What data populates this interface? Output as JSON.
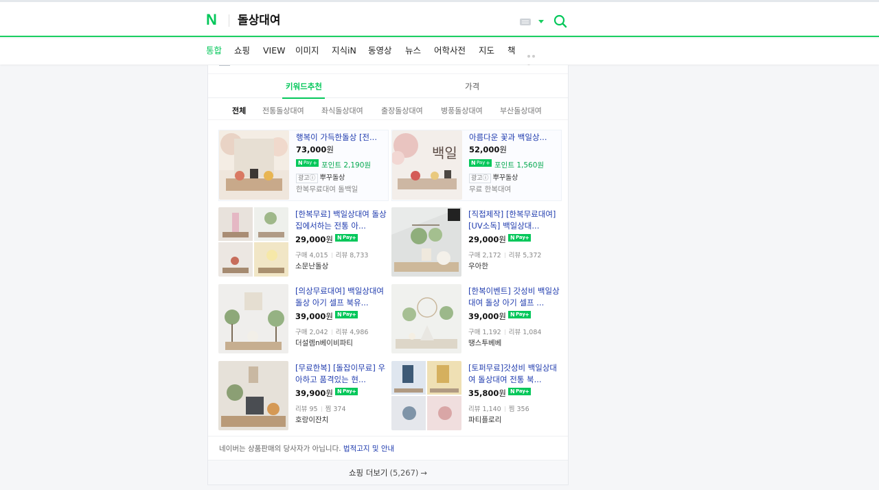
{
  "header": {
    "logo": "N",
    "query": "돌상대여",
    "search_icon": "search-icon",
    "keyboard_icon": "keyboard-icon",
    "accent_color": "#03c75a"
  },
  "tabs": [
    {
      "label": "통합",
      "active": true
    },
    {
      "label": "쇼핑"
    },
    {
      "label": "VIEW"
    },
    {
      "label": "이미지"
    },
    {
      "label": "지식iN"
    },
    {
      "label": "동영상"
    },
    {
      "label": "뉴스"
    },
    {
      "label": "어학사전"
    },
    {
      "label": "지도"
    },
    {
      "label": "책"
    }
  ],
  "shopping": {
    "subtabs": [
      {
        "label": "키워드추천",
        "active": true
      },
      {
        "label": "가격"
      }
    ],
    "filters": [
      {
        "label": "전체",
        "active": true
      },
      {
        "label": "전통돌상대여"
      },
      {
        "label": "좌식돌상대여"
      },
      {
        "label": "출장돌상대여"
      },
      {
        "label": "병풍돌상대여"
      },
      {
        "label": "부산돌상대여"
      }
    ],
    "products": [
      {
        "title": "행복이 가득한돌상 [전...",
        "price": "73,000",
        "won": "원",
        "npay": true,
        "points_label": "포인트",
        "points": "2,190원",
        "ad_label": "광고ⓘ",
        "ad_shop": "뿌꾸돌상",
        "seller": "한복무료대여 돌백일",
        "ad": true
      },
      {
        "title": "아름다운 꽃과 백일상...",
        "price": "52,000",
        "won": "원",
        "npay": true,
        "points_label": "포인트",
        "points": "1,560원",
        "ad_label": "광고ⓘ",
        "ad_shop": "뿌꾸돌상",
        "seller": "무료 한복대여",
        "ad": true
      },
      {
        "title": "[한복무료] 백일상대여 돌상 집에서하는 전통 아...",
        "price": "29,000",
        "won": "원",
        "npay": true,
        "stat1_label": "구매",
        "stat1": "4,015",
        "stat2_label": "리뷰",
        "stat2": "8,733",
        "seller": "소문난돌상"
      },
      {
        "title": "[직접제작] [한복무료대여] [UV소독] 백일상대...",
        "price": "29,000",
        "won": "원",
        "npay": true,
        "stat1_label": "구매",
        "stat1": "2,172",
        "stat2_label": "리뷰",
        "stat2": "5,372",
        "seller": "우아한"
      },
      {
        "title": "[의상무료대여] 백일상대여 돌상 아기 셀프 북유...",
        "price": "39,000",
        "won": "원",
        "npay": true,
        "stat1_label": "구매",
        "stat1": "2,042",
        "stat2_label": "리뷰",
        "stat2": "4,986",
        "seller": "더설렘n베이비파티"
      },
      {
        "title": "[한복이벤트] 갓성비 백일상대여 돌상 아기 셀프 ...",
        "price": "39,000",
        "won": "원",
        "npay": true,
        "stat1_label": "구매",
        "stat1": "1,192",
        "stat2_label": "리뷰",
        "stat2": "1,084",
        "seller": "땡스투베베"
      },
      {
        "title": "[무료한복] [돌잡이무료] 우아하고 품격있는 현...",
        "price": "39,900",
        "won": "원",
        "npay": true,
        "stat1_label": "리뷰",
        "stat1": "95",
        "stat2_label": "찜",
        "stat2": "374",
        "seller": "호랑이잔치"
      },
      {
        "title": "[토퍼무료]갓성비 백일상대여 돌상대여 전통 북...",
        "price": "35,800",
        "won": "원",
        "npay": true,
        "stat1_label": "리뷰",
        "stat1": "1,140",
        "stat2_label": "찜",
        "stat2": "356",
        "seller": "파티플로리"
      }
    ],
    "npay_badge": {
      "n": "N",
      "pay": "Pay",
      "plus": "+"
    },
    "notice_text": "네이버는 상품판매의 당사자가 아닙니다.",
    "notice_link": "법적고지 및 안내",
    "more_label": "쇼핑 더보기",
    "more_count": "(5,267)",
    "more_arrow": "→"
  }
}
